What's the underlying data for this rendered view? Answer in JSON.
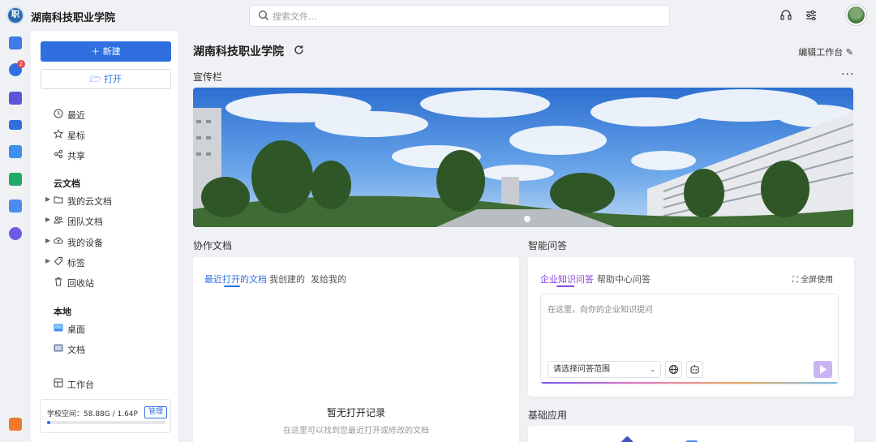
{
  "topbar": {
    "app_title": "湖南科技职业学院",
    "search_placeholder": "搜索文件..."
  },
  "rail": {
    "notification_count": "2"
  },
  "sidebar": {
    "new_label": "新建",
    "open_label": "打开",
    "nav": [
      {
        "label": "最近",
        "icon": "clock-icon"
      },
      {
        "label": "星标",
        "icon": "star-icon"
      },
      {
        "label": "共享",
        "icon": "share-icon"
      }
    ],
    "cloud_title": "云文档",
    "cloud_items": [
      {
        "label": "我的云文档",
        "icon": "folder-icon"
      },
      {
        "label": "团队文档",
        "icon": "team-icon"
      },
      {
        "label": "我的设备",
        "icon": "cloud-device-icon"
      },
      {
        "label": "标签",
        "icon": "tag-icon"
      }
    ],
    "trash_label": "回收站",
    "local_title": "本地",
    "local_items": [
      {
        "label": "桌面",
        "icon": "desktop-icon"
      },
      {
        "label": "文档",
        "icon": "document-folder-icon"
      }
    ],
    "workspace_label": "工作台",
    "quota": {
      "text": "学校空间：58.88G / 1.64P",
      "manage_label": "管理",
      "used_fraction": 0.03
    }
  },
  "main": {
    "title": "湖南科技职业学院",
    "edit_label": "编辑工作台",
    "banner_label": "宣传栏",
    "collab": {
      "title": "协作文档",
      "tabs": [
        "最近打开的文档",
        "我创建的",
        "发给我的"
      ],
      "empty_title": "暂无打开记录",
      "empty_sub": "在这里可以找到您最近打开或修改的文档"
    },
    "qa": {
      "title": "智能问答",
      "tabs": [
        "企业知识问答",
        "帮助中心问答"
      ],
      "fullscreen_label": "全屏使用",
      "input_placeholder": "在这里，向你的企业知识提问",
      "scope_placeholder": "请选择问答范围"
    },
    "basic_apps": {
      "title": "基础应用"
    }
  },
  "colors": {
    "accent": "#2f6fe0",
    "qa_accent": "#8b46d8",
    "badge": "#e5484d"
  }
}
